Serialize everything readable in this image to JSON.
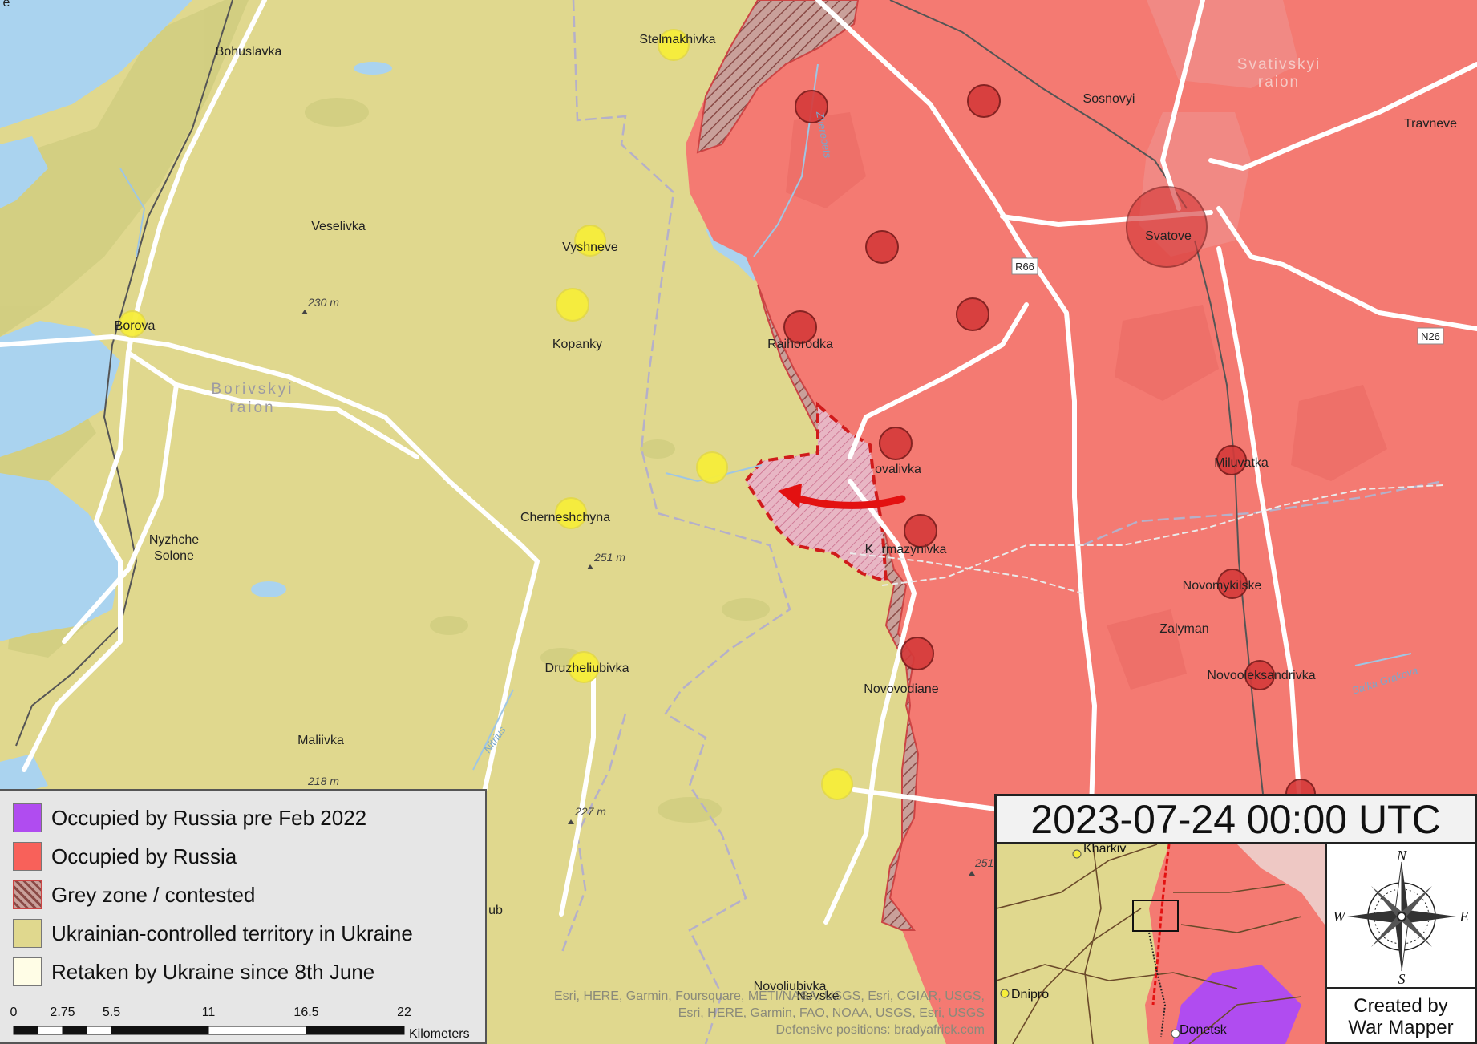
{
  "colors": {
    "ukraine": "#e0d88e",
    "russia": "#f47a72",
    "russia_pre2022": "#b04cf0",
    "retaken": "#fffde6",
    "water": "#aad3ef",
    "road": "#ffffff",
    "city_ua": "#f7ee3a",
    "city_ru": "#d63a3a"
  },
  "places": {
    "bohuslavka": "Bohuslavka",
    "stelmakhivka": "Stelmakhivka",
    "veselivka": "Veselivka",
    "vyshneve": "Vyshneve",
    "kopanky": "Kopanky",
    "borova": "Borova",
    "borivskyi": "Borivskyi",
    "raion1": "raion",
    "cherneshchyna": "Cherneshchyna",
    "nyzhche": "Nyzhche",
    "solone": "Solone",
    "druzheliubivka": "Druzheliubivka",
    "maliivka": "Maliivka",
    "sosnovyi": "Sosnovyi",
    "svativskyi": "Svativskyi",
    "raion2": "raion",
    "travneve": "Travneve",
    "svatove": "Svatove",
    "raihorodka": "Raihorodka",
    "novovalivka": "ovalivka",
    "kurmazynivka_a": "K",
    "kurmazynivka_b": "rmazynivka",
    "miluvatka": "Miluvatka",
    "novomykilske": "Novomykilske",
    "zalyman": "Zalyman",
    "novooleksandrivka": "Novooleksandrivka",
    "novovodiane": "Novovodiane",
    "novoliubivka": "Novoliubivka",
    "nevske": "Nevske",
    "ub": "ub",
    "edge_e": "e",
    "elev_230": "230 m",
    "elev_251a": "251 m",
    "elev_227": "227 m",
    "elev_218": "218 m",
    "elev_251b": "251",
    "river_zherebets": "Zherebets",
    "river_nitrius": "Nitrius",
    "river_balka": "Balka Grakova",
    "road_r66": "R66",
    "road_n26": "N26"
  },
  "legend": {
    "items": [
      {
        "label": "Occupied by Russia pre Feb 2022",
        "color": "#b04cf0"
      },
      {
        "label": "Occupied by Russia",
        "color": "#f8615a"
      },
      {
        "label": "Grey zone / contested",
        "color": "hatch"
      },
      {
        "label": "Ukrainian-controlled territory in Ukraine",
        "color": "#e0d88e"
      },
      {
        "label": "Retaken by Ukraine since 8th June",
        "color": "#fffde6"
      }
    ]
  },
  "scale": {
    "ticks": [
      "0",
      "2.75",
      "5.5",
      "11",
      "16.5",
      "22"
    ],
    "unit": "Kilometers"
  },
  "attribution": [
    "Esri, HERE, Garmin, Foursquare, METI/NASA, USGS, Esri, CGIAR, USGS,",
    "Esri, HERE, Garmin, FAO, NOAA, USGS, Esri, USGS",
    "Defensive positions: bradyafrick.com"
  ],
  "inset": {
    "date": "2023-07-24  00:00 UTC",
    "cities": {
      "kharkiv": "Kharkiv",
      "dnipro": "Dnipro",
      "donetsk": "Donetsk"
    },
    "credit_line1": "Created by",
    "credit_line2": "War Mapper",
    "compass": {
      "n": "N",
      "s": "S",
      "e": "E",
      "w": "W"
    }
  }
}
